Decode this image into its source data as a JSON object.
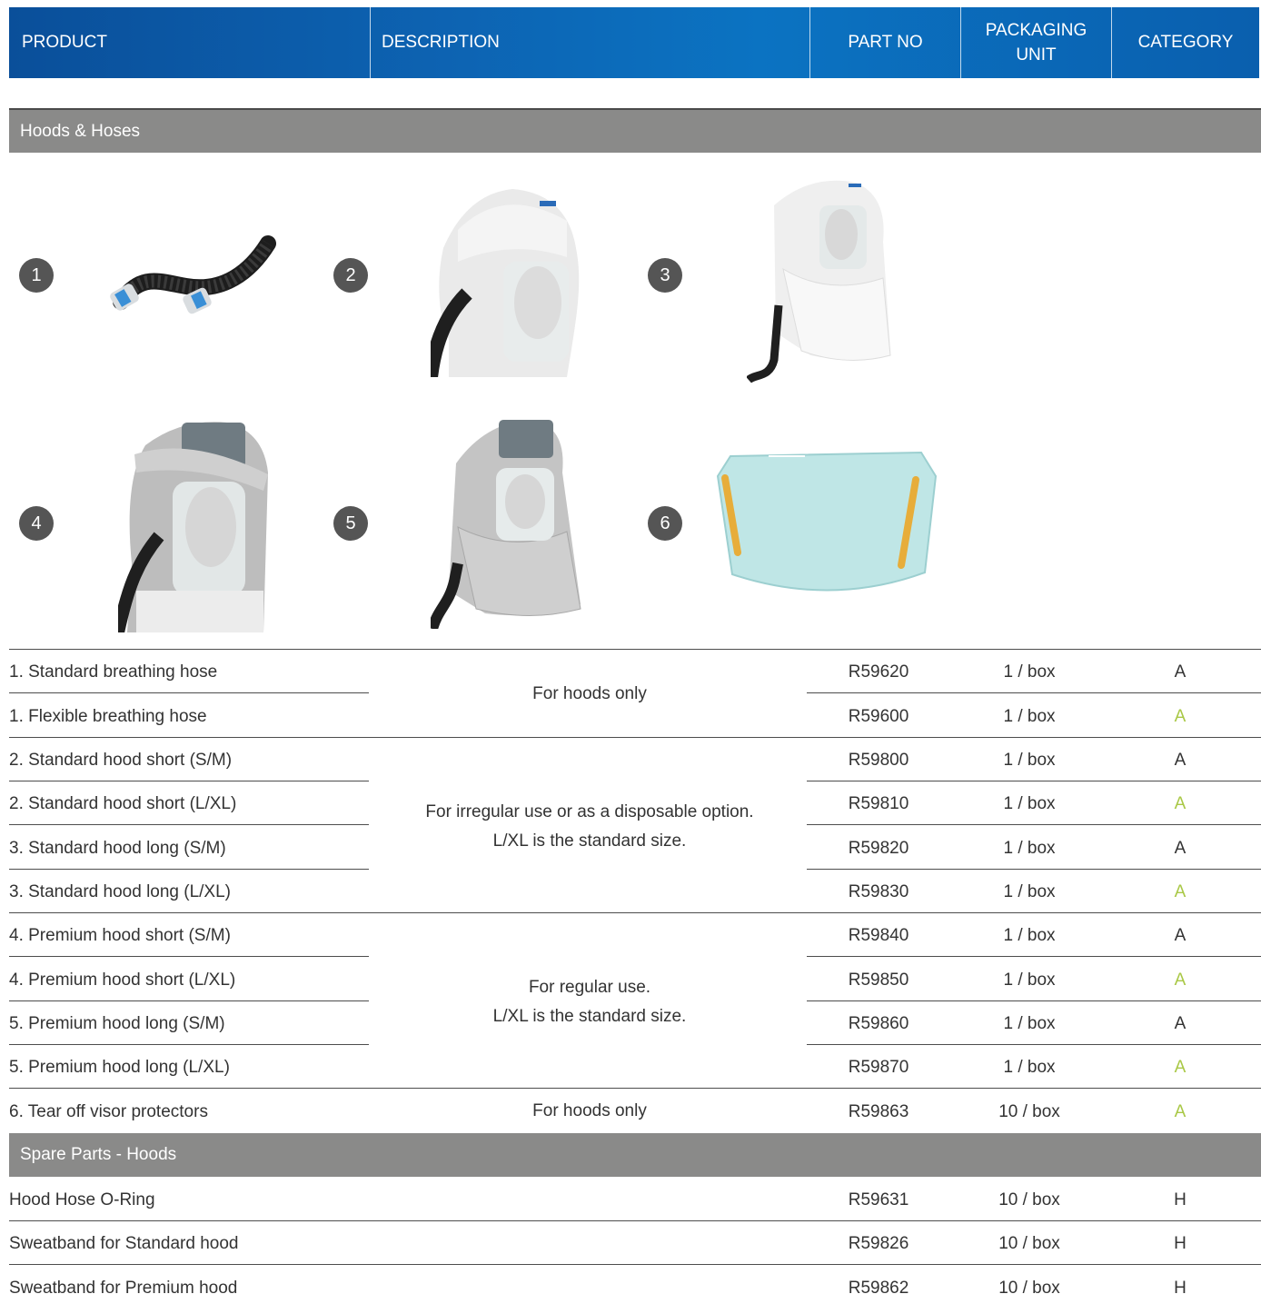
{
  "header": {
    "product": "PRODUCT",
    "description": "DESCRIPTION",
    "part_no": "PART NO",
    "packaging_unit_line1": "PACKAGING",
    "packaging_unit_line2": "UNIT",
    "category": "CATEGORY"
  },
  "sections": {
    "hoods_hoses": "Hoods & Hoses",
    "spare_parts": "Spare Parts - Hoods"
  },
  "gallery": [
    {
      "number": "1",
      "icon": "breathing-hose-icon"
    },
    {
      "number": "2",
      "icon": "standard-hood-short-icon"
    },
    {
      "number": "3",
      "icon": "standard-hood-long-icon"
    },
    {
      "number": "4",
      "icon": "premium-hood-short-icon"
    },
    {
      "number": "5",
      "icon": "premium-hood-long-icon"
    },
    {
      "number": "6",
      "icon": "visor-protector-icon"
    }
  ],
  "descriptions": {
    "hoses": "For hoods only",
    "standard_line1": "For irregular use or as a disposable option.",
    "standard_line2": "L/XL is the standard size.",
    "premium_line1": "For regular use.",
    "premium_line2": "L/XL is the standard size.",
    "visor": "For hoods only"
  },
  "rows": [
    {
      "name": "1. Standard breathing hose",
      "part": "R59620",
      "pack": "1 / box",
      "cat": "A",
      "cat_color": "#333333"
    },
    {
      "name": "1. Flexible breathing hose",
      "part": "R59600",
      "pack": "1 / box",
      "cat": "A",
      "cat_color": "#a9c846"
    },
    {
      "name": "2. Standard hood short (S/M)",
      "part": "R59800",
      "pack": "1 / box",
      "cat": "A",
      "cat_color": "#333333"
    },
    {
      "name": "2. Standard hood short (L/XL)",
      "part": "R59810",
      "pack": "1 / box",
      "cat": "A",
      "cat_color": "#a9c846"
    },
    {
      "name": "3. Standard hood long (S/M)",
      "part": "R59820",
      "pack": "1 / box",
      "cat": "A",
      "cat_color": "#333333"
    },
    {
      "name": "3. Standard hood long (L/XL)",
      "part": "R59830",
      "pack": "1 / box",
      "cat": "A",
      "cat_color": "#a9c846"
    },
    {
      "name": "4. Premium hood short (S/M)",
      "part": "R59840",
      "pack": "1 / box",
      "cat": "A",
      "cat_color": "#333333"
    },
    {
      "name": "4. Premium hood short (L/XL)",
      "part": "R59850",
      "pack": "1 / box",
      "cat": "A",
      "cat_color": "#a9c846"
    },
    {
      "name": "5. Premium hood long (S/M)",
      "part": "R59860",
      "pack": "1 / box",
      "cat": "A",
      "cat_color": "#333333"
    },
    {
      "name": "5. Premium hood long (L/XL)",
      "part": "R59870",
      "pack": "1 / box",
      "cat": "A",
      "cat_color": "#a9c846"
    },
    {
      "name": "6. Tear off visor protectors",
      "part": "R59863",
      "pack": "10 / box",
      "cat": "A",
      "cat_color": "#a9c846"
    }
  ],
  "spare_rows": [
    {
      "name": "Hood Hose O-Ring",
      "part": "R59631",
      "pack": "10 / box",
      "cat": "H"
    },
    {
      "name": "Sweatband for Standard hood",
      "part": "R59826",
      "pack": "10 / box",
      "cat": "H"
    },
    {
      "name": "Sweatband for Premium hood",
      "part": "R59862",
      "pack": "10 / box",
      "cat": "H"
    }
  ]
}
